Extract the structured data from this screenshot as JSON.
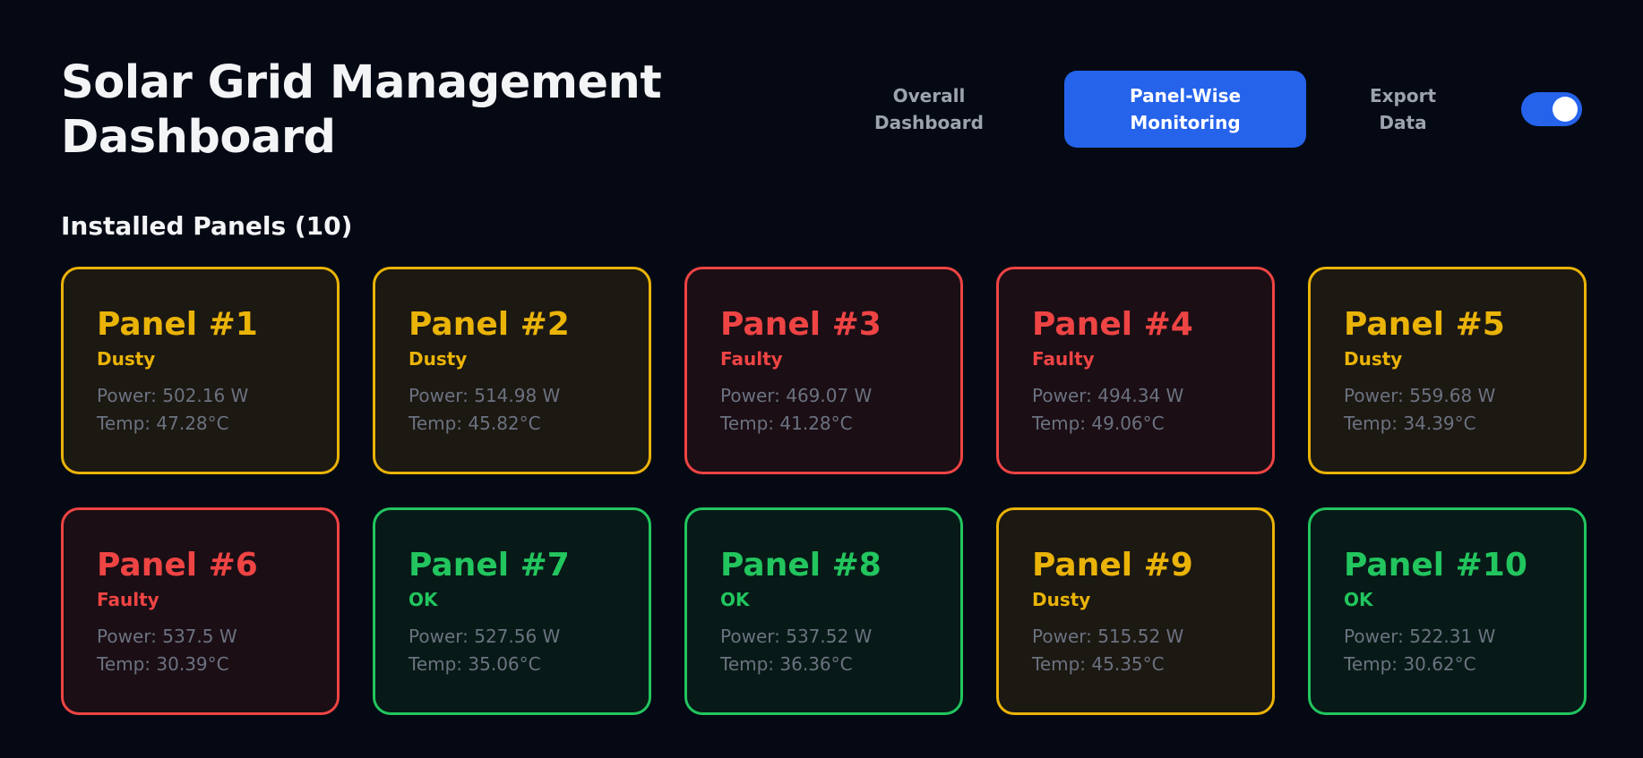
{
  "header": {
    "title": "Solar Grid Management Dashboard"
  },
  "nav": {
    "overall": "Overall\nDashboard",
    "panel_wise": "Panel-Wise\nMonitoring",
    "export": "Export\nData",
    "active": "panel_wise",
    "toggle_on": true
  },
  "section": {
    "title": "Installed Panels (10)"
  },
  "colors": {
    "background": "#050914",
    "accent": "#2563eb",
    "dusty": "#eab308",
    "faulty": "#ef4444",
    "ok": "#22c55e"
  },
  "panels": [
    {
      "name": "Panel #1",
      "status": "Dusty",
      "power": "Power: 502.16 W",
      "temp": "Temp: 47.28°C"
    },
    {
      "name": "Panel #2",
      "status": "Dusty",
      "power": "Power: 514.98 W",
      "temp": "Temp: 45.82°C"
    },
    {
      "name": "Panel #3",
      "status": "Faulty",
      "power": "Power: 469.07 W",
      "temp": "Temp: 41.28°C"
    },
    {
      "name": "Panel #4",
      "status": "Faulty",
      "power": "Power: 494.34 W",
      "temp": "Temp: 49.06°C"
    },
    {
      "name": "Panel #5",
      "status": "Dusty",
      "power": "Power: 559.68 W",
      "temp": "Temp: 34.39°C"
    },
    {
      "name": "Panel #6",
      "status": "Faulty",
      "power": "Power: 537.5 W",
      "temp": "Temp: 30.39°C"
    },
    {
      "name": "Panel #7",
      "status": "OK",
      "power": "Power: 527.56 W",
      "temp": "Temp: 35.06°C"
    },
    {
      "name": "Panel #8",
      "status": "OK",
      "power": "Power: 537.52 W",
      "temp": "Temp: 36.36°C"
    },
    {
      "name": "Panel #9",
      "status": "Dusty",
      "power": "Power: 515.52 W",
      "temp": "Temp: 45.35°C"
    },
    {
      "name": "Panel #10",
      "status": "OK",
      "power": "Power: 522.31 W",
      "temp": "Temp: 30.62°C"
    }
  ]
}
